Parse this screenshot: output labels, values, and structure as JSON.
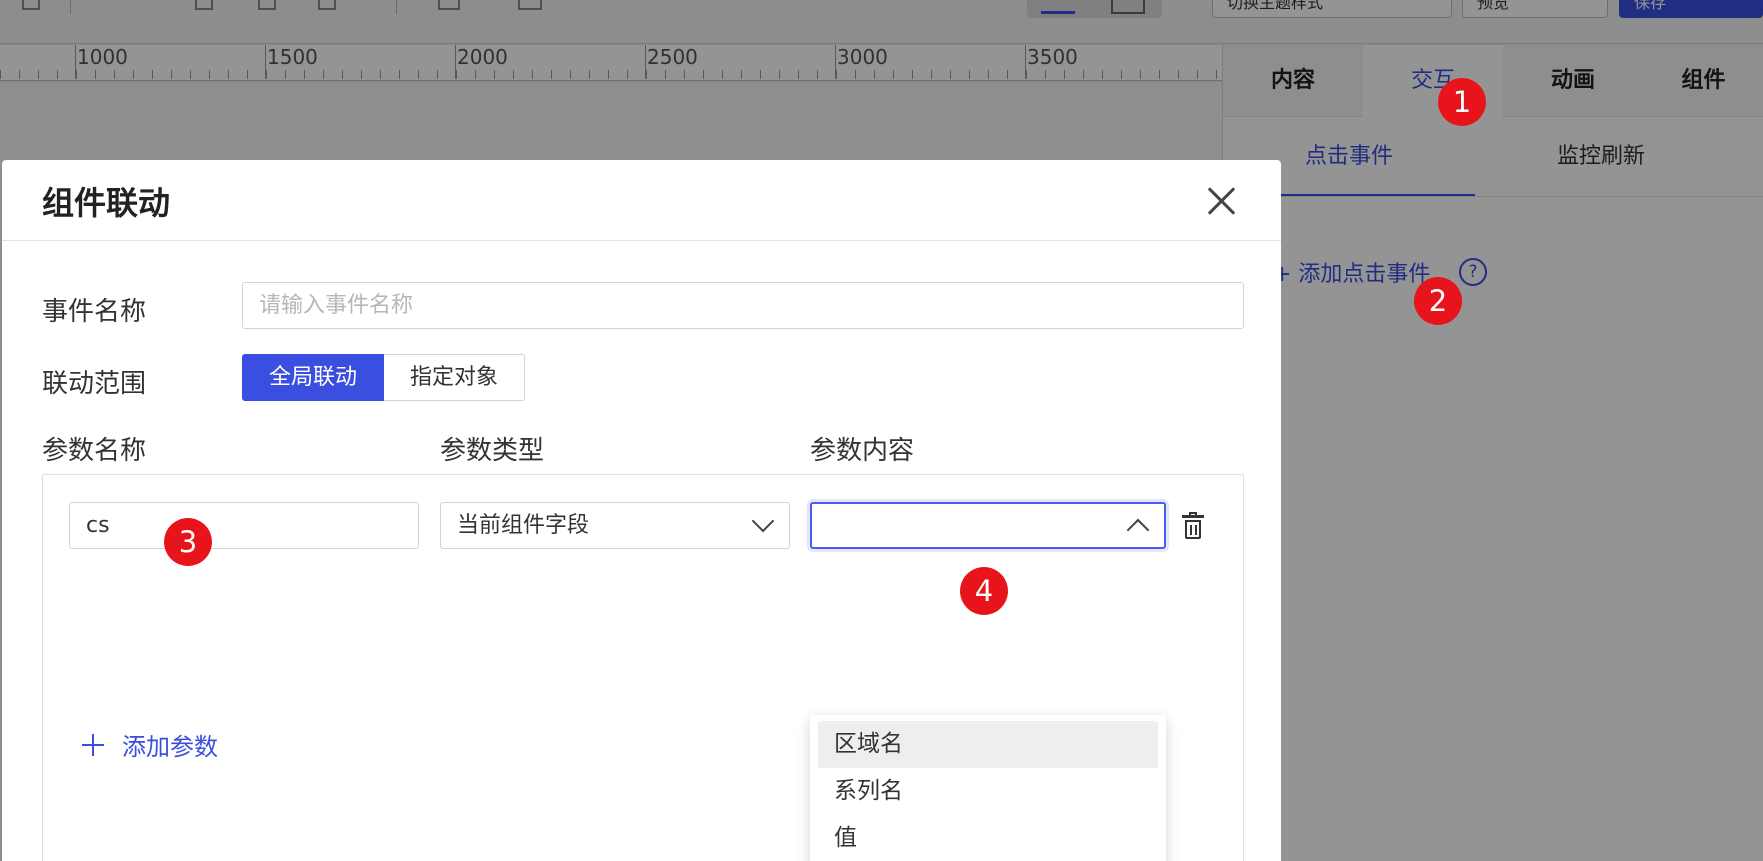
{
  "ruler": {
    "labels": [
      "1000",
      "1500",
      "2000",
      "2500",
      "3000",
      "3500"
    ]
  },
  "toolbar": {
    "btn_style": "切换主题样式",
    "btn_preview": "预览",
    "btn_save": "保存"
  },
  "right_panel": {
    "tabs": [
      "内容",
      "交互",
      "动画",
      "组件"
    ],
    "active_tab": "交互",
    "sub_tabs": [
      "点击事件",
      "监控刷新"
    ],
    "add_click_event": "+ 添加点击事件",
    "help_icon": "?"
  },
  "modal": {
    "title": "组件联动",
    "event_name_label": "事件名称",
    "event_name_placeholder": "请输入事件名称",
    "scope_label": "联动范围",
    "scope_options": [
      "全局联动",
      "指定对象"
    ],
    "scope_selected": "全局联动",
    "col_param_name": "参数名称",
    "col_param_type": "参数类型",
    "col_param_content": "参数内容",
    "param_row": {
      "name": "cs",
      "type": "当前组件字段",
      "content": ""
    },
    "add_param": "添加参数",
    "dropdown_options": [
      "区域名",
      "系列名",
      "值"
    ],
    "dropdown_hovered": "区域名"
  },
  "badges": [
    "1",
    "2",
    "3",
    "4"
  ],
  "colors": {
    "accent": "#3a4fe0",
    "badge": "#e8141b"
  }
}
